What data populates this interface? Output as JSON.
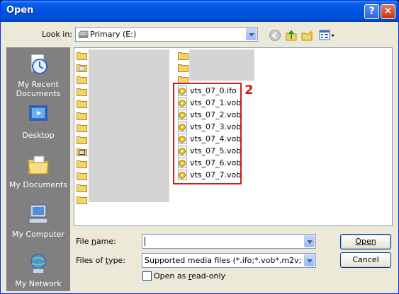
{
  "window": {
    "title": "Open"
  },
  "lookin": {
    "label": "Look in:",
    "value": "Primary (E:)"
  },
  "places": [
    {
      "label_line1": "My Recent",
      "label_line2": "Documents",
      "icon": "recent-documents-icon"
    },
    {
      "label_line1": "Desktop",
      "label_line2": "",
      "icon": "desktop-icon"
    },
    {
      "label_line1": "My Documents",
      "label_line2": "",
      "icon": "my-documents-icon"
    },
    {
      "label_line1": "My Computer",
      "label_line2": "",
      "icon": "my-computer-icon"
    },
    {
      "label_line1": "My Network",
      "label_line2": "",
      "icon": "my-network-icon"
    }
  ],
  "files": [
    {
      "name": "vts_07_0.ifo"
    },
    {
      "name": "vts_07_1.vob"
    },
    {
      "name": "vts_07_2.vob"
    },
    {
      "name": "vts_07_3.vob"
    },
    {
      "name": "vts_07_4.vob"
    },
    {
      "name": "vts_07_5.vob"
    },
    {
      "name": "vts_07_6.vob"
    },
    {
      "name": "vts_07_7.vob"
    }
  ],
  "annotation": {
    "number": "2"
  },
  "filename": {
    "label": "File name:",
    "label_ul": "n",
    "value": ""
  },
  "filetype": {
    "label": "Files of type:",
    "value": "Supported media files (*.ifo;*.vob*.m2v;*.mpg;*.m"
  },
  "readonly": {
    "label": "Open as read-only",
    "checked": false
  },
  "buttons": {
    "open": "Open",
    "cancel": "Cancel"
  },
  "colors": {
    "title_bar": "#0054e3",
    "highlight": "#d11a1a",
    "places_bg": "#808080"
  }
}
